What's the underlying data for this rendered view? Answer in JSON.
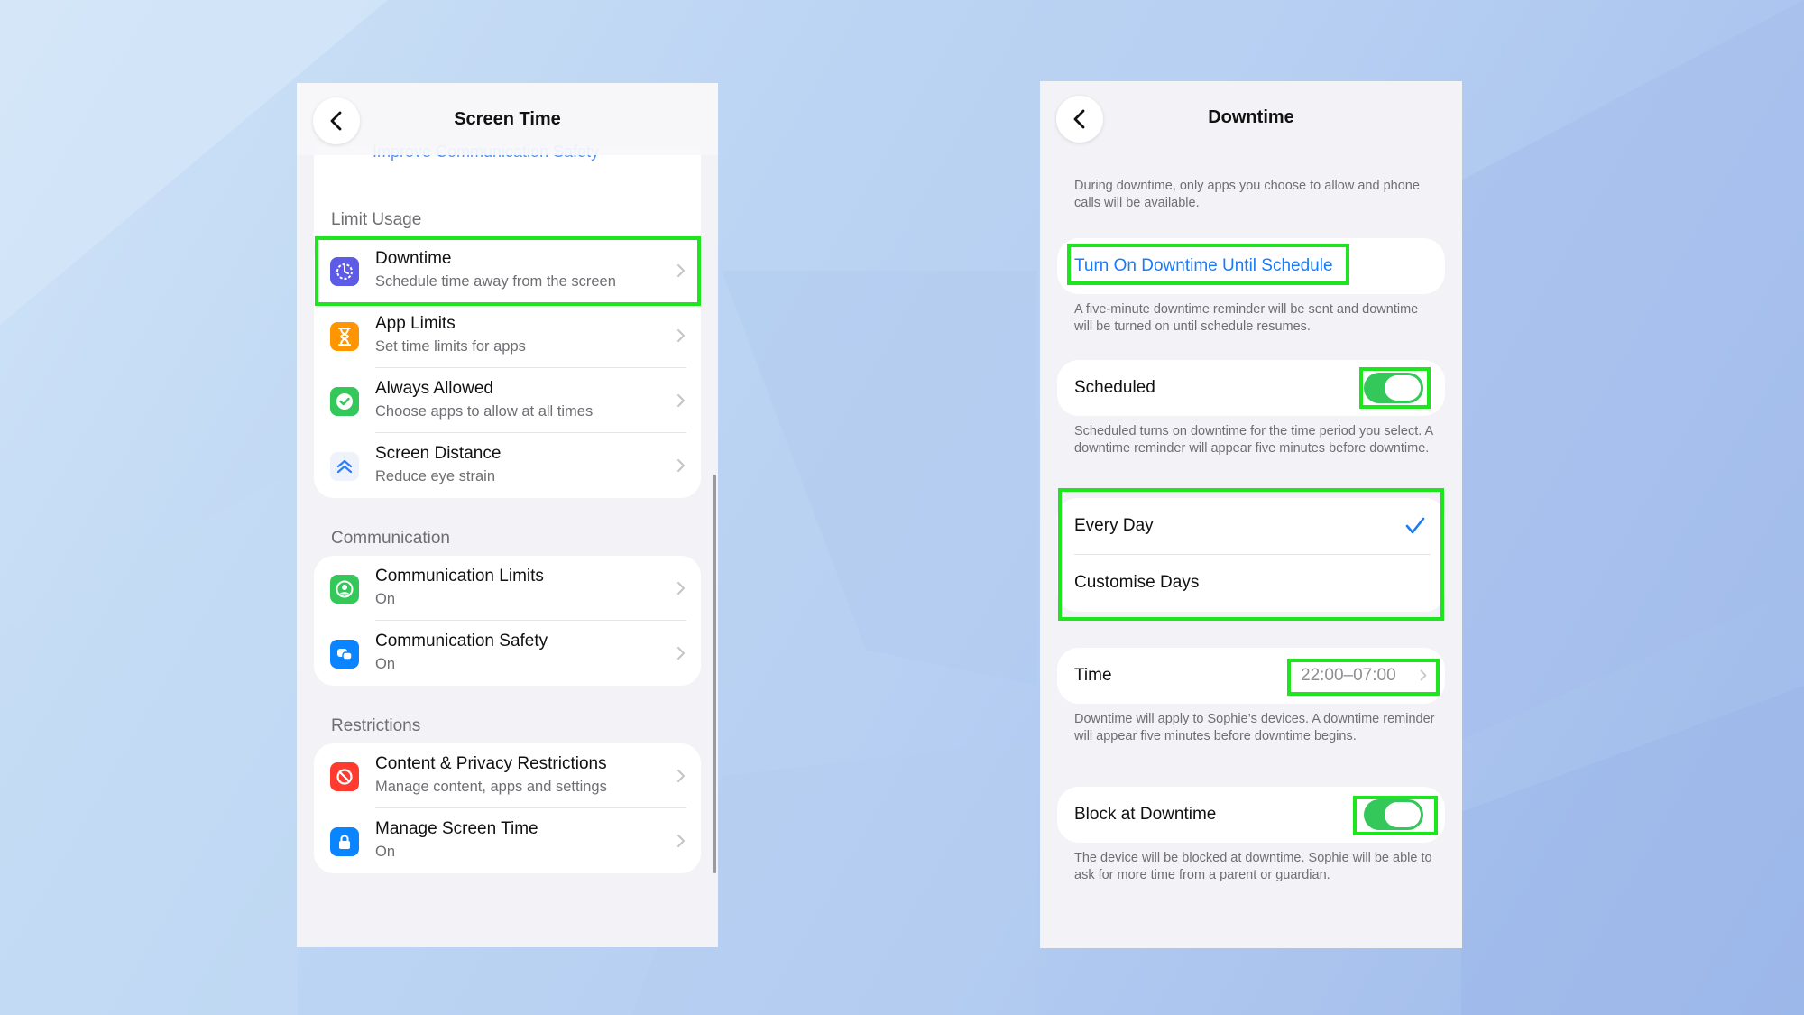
{
  "left": {
    "nav_title": "Screen Time",
    "ghost_link": "Improve Communication Safety",
    "sections": [
      {
        "header": "Limit Usage",
        "rows": [
          {
            "title": "Downtime",
            "subtitle": "Schedule time away from the screen",
            "icon": "moon-clock-icon",
            "color": "#5e5ce6"
          },
          {
            "title": "App Limits",
            "subtitle": "Set time limits for apps",
            "icon": "hourglass-icon",
            "color": "#ff9500"
          },
          {
            "title": "Always Allowed",
            "subtitle": "Choose apps to allow at all times",
            "icon": "checkmark-seal-icon",
            "color": "#34c759"
          },
          {
            "title": "Screen Distance",
            "subtitle": "Reduce eye strain",
            "icon": "chevrons-up-icon",
            "color": "#2f7df6"
          }
        ]
      },
      {
        "header": "Communication",
        "rows": [
          {
            "title": "Communication Limits",
            "subtitle": "On",
            "icon": "person-circle-icon",
            "color": "#34c759"
          },
          {
            "title": "Communication Safety",
            "subtitle": "On",
            "icon": "chat-bubbles-icon",
            "color": "#0a84ff"
          }
        ]
      },
      {
        "header": "Restrictions",
        "rows": [
          {
            "title": "Content & Privacy Restrictions",
            "subtitle": "Manage content, apps and settings",
            "icon": "no-entry-icon",
            "color": "#ff3b30"
          },
          {
            "title": "Manage Screen Time",
            "subtitle": "On",
            "icon": "lock-icon",
            "color": "#0a84ff"
          }
        ]
      }
    ]
  },
  "right": {
    "nav_title": "Downtime",
    "intro": "During downtime, only apps you choose to allow and phone calls will be available.",
    "turn_on_label": "Turn On Downtime Until Schedule",
    "turn_on_note": "A five-minute downtime reminder will be sent and downtime will be turned on until schedule resumes.",
    "scheduled_label": "Scheduled",
    "scheduled_on": true,
    "scheduled_note": "Scheduled turns on downtime for the time period you select. A downtime reminder will appear five minutes before downtime.",
    "every_day_label": "Every Day",
    "customise_days_label": "Customise Days",
    "time_label": "Time",
    "time_value": "22:00–07:00",
    "time_note": "Downtime will apply to Sophie’s devices. A downtime reminder will appear five minutes before downtime begins.",
    "block_label": "Block at Downtime",
    "block_on": true,
    "block_note": "The device will be blocked at downtime. Sophie will be able to ask for more time from a parent or guardian."
  },
  "colors": {
    "accent": "#1a7cf5",
    "toggle_on": "#34c759",
    "highlight": "#1ee61e"
  }
}
